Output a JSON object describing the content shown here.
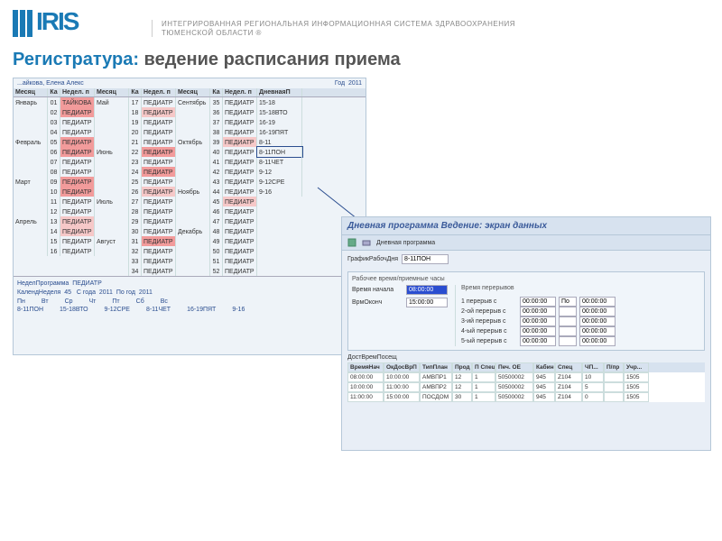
{
  "brand": {
    "name": "IRIS"
  },
  "tagline_l1": "ИНТЕГРИРОВАННАЯ РЕГИОНАЛЬНАЯ ИНФОРМАЦИОННАЯ СИСТЕМА ЗДРАВООХРАНЕНИЯ",
  "tagline_l2": "ТЮМЕНСКОЙ ОБЛАСТИ ®",
  "title_accent": "Регистратура:",
  "title_rest": " ведение расписания приема",
  "left": {
    "owner": "...айкова, Елена Алекс",
    "year_label": "Год",
    "year": "2011",
    "hdr": {
      "m": "Месяц",
      "k": "Ка",
      "n": "Недел. п",
      "d": "ДневнаяП"
    },
    "block1": [
      {
        "m": "Январь",
        "k": "01",
        "n": "ТАЙКОВА",
        "cls": "hot"
      },
      {
        "m": "",
        "k": "02",
        "n": "ПЕДИАТР",
        "cls": "hot"
      },
      {
        "m": "",
        "k": "03",
        "n": "ПЕДИАТР",
        "cls": ""
      },
      {
        "m": "",
        "k": "04",
        "n": "ПЕДИАТР",
        "cls": ""
      },
      {
        "m": "Февраль",
        "k": "05",
        "n": "ПЕДИАТР",
        "cls": "hot"
      },
      {
        "m": "",
        "k": "06",
        "n": "ПЕДИАТР",
        "cls": "hot"
      },
      {
        "m": "",
        "k": "07",
        "n": "ПЕДИАТР",
        "cls": ""
      },
      {
        "m": "",
        "k": "08",
        "n": "ПЕДИАТР",
        "cls": ""
      },
      {
        "m": "Март",
        "k": "09",
        "n": "ПЕДИАТР",
        "cls": "hot"
      },
      {
        "m": "",
        "k": "10",
        "n": "ПЕДИАТР",
        "cls": "hot"
      },
      {
        "m": "",
        "k": "11",
        "n": "ПЕДИАТР",
        "cls": ""
      },
      {
        "m": "",
        "k": "12",
        "n": "ПЕДИАТР",
        "cls": ""
      },
      {
        "m": "Апрель",
        "k": "13",
        "n": "ПЕДИАТР",
        "cls": "hot2"
      },
      {
        "m": "",
        "k": "14",
        "n": "ПЕДИАТР",
        "cls": "hot2"
      },
      {
        "m": "",
        "k": "15",
        "n": "ПЕДИАТР",
        "cls": ""
      },
      {
        "m": "",
        "k": "16",
        "n": "ПЕДИАТР",
        "cls": ""
      }
    ],
    "block2": [
      {
        "m": "Май",
        "k": "17",
        "n": "ПЕДИАТР",
        "cls": ""
      },
      {
        "m": "",
        "k": "18",
        "n": "ПЕДИАТР",
        "cls": "hot2"
      },
      {
        "m": "",
        "k": "19",
        "n": "ПЕДИАТР",
        "cls": ""
      },
      {
        "m": "",
        "k": "20",
        "n": "ПЕДИАТР",
        "cls": ""
      },
      {
        "m": "",
        "k": "21",
        "n": "ПЕДИАТР",
        "cls": ""
      },
      {
        "m": "Июнь",
        "k": "22",
        "n": "ПЕДИАТР",
        "cls": "hot"
      },
      {
        "m": "",
        "k": "23",
        "n": "ПЕДИАТР",
        "cls": ""
      },
      {
        "m": "",
        "k": "24",
        "n": "ПЕДИАТР",
        "cls": "hot"
      },
      {
        "m": "",
        "k": "25",
        "n": "ПЕДИАТР",
        "cls": ""
      },
      {
        "m": "",
        "k": "26",
        "n": "ПЕДИАТР",
        "cls": "hot2"
      },
      {
        "m": "Июль",
        "k": "27",
        "n": "ПЕДИАТР",
        "cls": ""
      },
      {
        "m": "",
        "k": "28",
        "n": "ПЕДИАТР",
        "cls": ""
      },
      {
        "m": "",
        "k": "29",
        "n": "ПЕДИАТР",
        "cls": ""
      },
      {
        "m": "",
        "k": "30",
        "n": "ПЕДИАТР",
        "cls": ""
      },
      {
        "m": "Август",
        "k": "31",
        "n": "ПЕДИАТР",
        "cls": "hot"
      },
      {
        "m": "",
        "k": "32",
        "n": "ПЕДИАТР",
        "cls": ""
      },
      {
        "m": "",
        "k": "33",
        "n": "ПЕДИАТР",
        "cls": ""
      },
      {
        "m": "",
        "k": "34",
        "n": "ПЕДИАТР",
        "cls": ""
      }
    ],
    "block3": [
      {
        "m": "Сентябрь",
        "k": "35",
        "n": "ПЕДИАТР",
        "cls": ""
      },
      {
        "m": "",
        "k": "36",
        "n": "ПЕДИАТР",
        "cls": ""
      },
      {
        "m": "",
        "k": "37",
        "n": "ПЕДИАТР",
        "cls": ""
      },
      {
        "m": "",
        "k": "38",
        "n": "ПЕДИАТР",
        "cls": ""
      },
      {
        "m": "Октябрь",
        "k": "39",
        "n": "ПЕДИАТР",
        "cls": "hot2"
      },
      {
        "m": "",
        "k": "40",
        "n": "ПЕДИАТР",
        "cls": ""
      },
      {
        "m": "",
        "k": "41",
        "n": "ПЕДИАТР",
        "cls": ""
      },
      {
        "m": "",
        "k": "42",
        "n": "ПЕДИАТР",
        "cls": ""
      },
      {
        "m": "",
        "k": "43",
        "n": "ПЕДИАТР",
        "cls": ""
      },
      {
        "m": "Ноябрь",
        "k": "44",
        "n": "ПЕДИАТР",
        "cls": ""
      },
      {
        "m": "",
        "k": "45",
        "n": "ПЕДИАТР",
        "cls": "hot2"
      },
      {
        "m": "",
        "k": "46",
        "n": "ПЕДИАТР",
        "cls": ""
      },
      {
        "m": "",
        "k": "47",
        "n": "ПЕДИАТР",
        "cls": ""
      },
      {
        "m": "Декабрь",
        "k": "48",
        "n": "ПЕДИАТР",
        "cls": ""
      },
      {
        "m": "",
        "k": "49",
        "n": "ПЕДИАТР",
        "cls": ""
      },
      {
        "m": "",
        "k": "50",
        "n": "ПЕДИАТР",
        "cls": ""
      },
      {
        "m": "",
        "k": "51",
        "n": "ПЕДИАТР",
        "cls": ""
      },
      {
        "m": "",
        "k": "52",
        "n": "ПЕДИАТР",
        "cls": ""
      }
    ],
    "daily": [
      "15-18",
      "15-18ВТО",
      "16-19",
      "16-19ПЯТ",
      "8-11",
      "8-11ПОН",
      "8-11ЧЕТ",
      "9-12",
      "9-12СРЕ",
      "9-16"
    ],
    "summary": {
      "l1a": "НеделПрограмма",
      "l1b": "ПЕДИАТР",
      "l2a": "КалендНеделя",
      "l2b": "45",
      "l2c": "С года",
      "l2d": "2011",
      "l2e": "По год",
      "l2f": "2011",
      "days": [
        "Пн",
        "Вт",
        "Ср",
        "Чт",
        "Пт",
        "Сб",
        "Вс"
      ],
      "sched": [
        "8-11ПОН",
        "15-18ВТО",
        "9-12СРЕ",
        "8-11ЧЕТ",
        "16-19ПЯТ",
        "9-16",
        ""
      ]
    }
  },
  "right": {
    "title": "Дневная программа Ведение: экран данных",
    "toolbar_label": "Дневная программа",
    "graphic_lbl": "ГрафикРабочДня",
    "graphic_val": "8-11ПОН",
    "group1": "Рабочее время/приемные часы",
    "start_lbl": "Время начала",
    "start_val": "08:00:00",
    "end_lbl": "ВрмОконч",
    "end_val": "15:00:00",
    "group2": "Время перерывов",
    "breaks": [
      {
        "lbl": "1 перерыв с",
        "t": "00:00:00",
        "d": "По",
        "t2": "00:00:00"
      },
      {
        "lbl": "2-ой перерыв с",
        "t": "00:00:00",
        "d": "",
        "t2": "00:00:00"
      },
      {
        "lbl": "3-ий перерыв с",
        "t": "00:00:00",
        "d": "",
        "t2": "00:00:00"
      },
      {
        "lbl": "4-ый перерыв с",
        "t": "00:00:00",
        "d": "",
        "t2": "00:00:00"
      },
      {
        "lbl": "5-ый перерыв с",
        "t": "00:00:00",
        "d": "",
        "t2": "00:00:00"
      }
    ],
    "visits_title": "ДостВремПосещ",
    "visits_hdr": [
      "ВремяНач",
      "ОкДосВрП",
      "ТипПлан",
      "Прод",
      "П Спец.",
      "Печ. ОЕ",
      "Кабинет",
      "Спец",
      "ЧП...",
      "П/пр",
      "Учр..."
    ],
    "visits": [
      [
        "08:00:00",
        "10:00:00",
        "АМВПР1",
        "12",
        "1",
        "50500002",
        "945",
        "Z104",
        "10",
        "",
        "1505"
      ],
      [
        "10:00:00",
        "11:00:00",
        "АМВПР2",
        "12",
        "1",
        "50500002",
        "945",
        "Z104",
        "5",
        "",
        "1505"
      ],
      [
        "11:00:00",
        "15:00:00",
        "ПОСДОМ",
        "30",
        "1",
        "50500002",
        "945",
        "Z104",
        "0",
        "",
        "1505"
      ]
    ]
  }
}
